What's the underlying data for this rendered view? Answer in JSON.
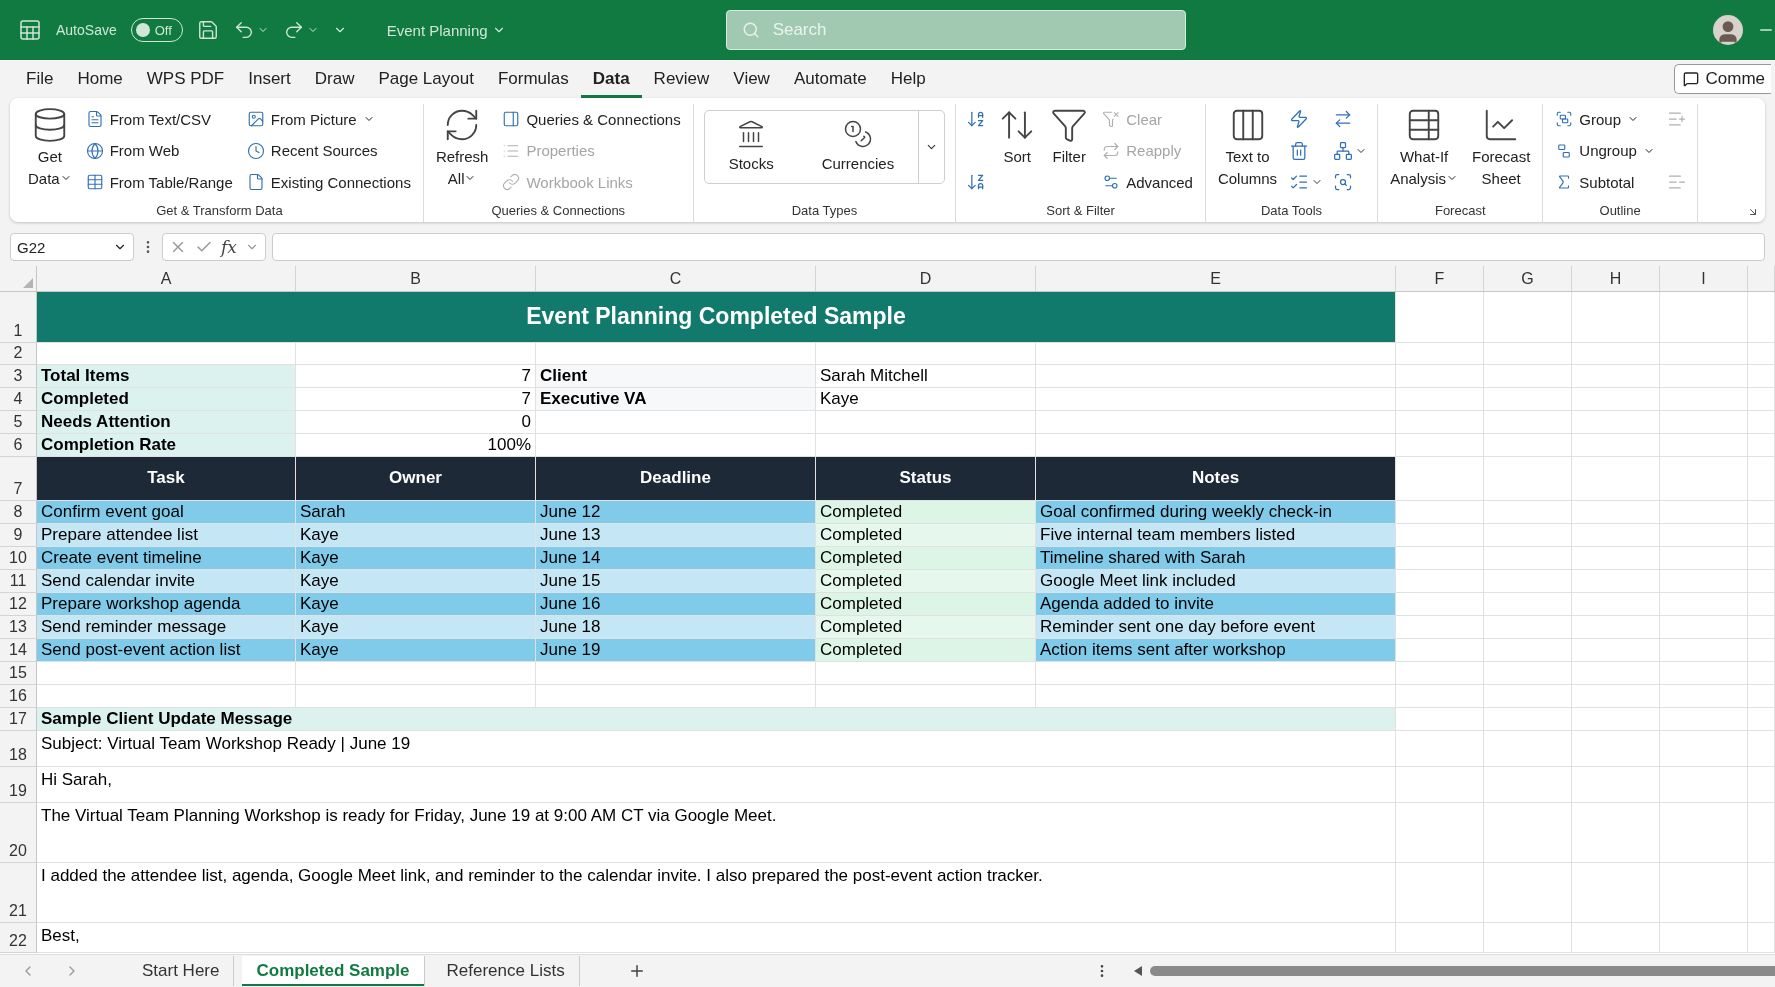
{
  "title_bar": {
    "autosave_label": "AutoSave",
    "autosave_toggle": {
      "label": "Off",
      "on": false
    },
    "document_title": "Event Planning",
    "search": {
      "placeholder": "Search"
    }
  },
  "menu_tabs": [
    {
      "label": "File",
      "selected": false
    },
    {
      "label": "Home",
      "selected": false
    },
    {
      "label": "WPS PDF",
      "selected": false
    },
    {
      "label": "Insert",
      "selected": false
    },
    {
      "label": "Draw",
      "selected": false
    },
    {
      "label": "Page Layout",
      "selected": false
    },
    {
      "label": "Formulas",
      "selected": false
    },
    {
      "label": "Data",
      "selected": true
    },
    {
      "label": "Review",
      "selected": false
    },
    {
      "label": "View",
      "selected": false
    },
    {
      "label": "Automate",
      "selected": false
    },
    {
      "label": "Help",
      "selected": false
    }
  ],
  "comments_button": "Comme",
  "ribbon": {
    "groups": [
      {
        "label": "Get & Transform Data",
        "columns": [
          {
            "kind": "large",
            "lines": [
              "Get",
              "Data"
            ],
            "caret": true
          },
          {
            "kind": "stack",
            "items": [
              {
                "label": "From Text/CSV",
                "disabled": false,
                "caret": false
              },
              {
                "label": "From Web",
                "disabled": false,
                "caret": false
              },
              {
                "label": "From Table/Range",
                "disabled": false,
                "caret": false
              }
            ]
          },
          {
            "kind": "stack",
            "items": [
              {
                "label": "From Picture",
                "disabled": false,
                "caret": true
              },
              {
                "label": "Recent Sources",
                "disabled": false,
                "caret": false
              },
              {
                "label": "Existing Connections",
                "disabled": false,
                "caret": false
              }
            ]
          }
        ]
      },
      {
        "label": "Queries & Connections",
        "columns": [
          {
            "kind": "large",
            "lines": [
              "Refresh",
              "All"
            ],
            "caret": true
          },
          {
            "kind": "stack",
            "items": [
              {
                "label": "Queries & Connections",
                "disabled": false,
                "caret": false
              },
              {
                "label": "Properties",
                "disabled": true,
                "caret": false
              },
              {
                "label": "Workbook Links",
                "disabled": true,
                "caret": false
              }
            ]
          }
        ]
      },
      {
        "label": "Data Types",
        "columns": [
          {
            "kind": "gallery",
            "items": [
              "Stocks",
              "Currencies"
            ]
          }
        ]
      },
      {
        "label": "Sort & Filter",
        "columns": [
          {
            "kind": "icons",
            "items": [
              {
                "disabled": false,
                "caret": false
              },
              {
                "disabled": false,
                "caret": false
              }
            ]
          },
          {
            "kind": "large",
            "lines": [
              "Sort"
            ],
            "caret": false
          },
          {
            "kind": "large",
            "lines": [
              "Filter"
            ],
            "caret": false
          },
          {
            "kind": "stack",
            "items": [
              {
                "label": "Clear",
                "disabled": true,
                "caret": false
              },
              {
                "label": "Reapply",
                "disabled": true,
                "caret": false
              },
              {
                "label": "Advanced",
                "disabled": false,
                "caret": false
              }
            ]
          }
        ]
      },
      {
        "label": "Data Tools",
        "columns": [
          {
            "kind": "large",
            "lines": [
              "Text to",
              "Columns"
            ],
            "caret": false
          },
          {
            "kind": "icons",
            "items": [
              {
                "disabled": false,
                "caret": false
              },
              {
                "disabled": false,
                "caret": false
              },
              {
                "disabled": false,
                "caret": true
              }
            ]
          },
          {
            "kind": "icons",
            "items": [
              {
                "disabled": false,
                "caret": false
              },
              {
                "disabled": false,
                "caret": true
              },
              {
                "disabled": false,
                "caret": false
              }
            ]
          }
        ]
      },
      {
        "label": "Forecast",
        "columns": [
          {
            "kind": "large",
            "lines": [
              "What-If",
              "Analysis"
            ],
            "caret": true
          },
          {
            "kind": "large",
            "lines": [
              "Forecast",
              "Sheet"
            ],
            "caret": false
          }
        ]
      },
      {
        "label": "Outline",
        "columns": [
          {
            "kind": "stack",
            "items": [
              {
                "label": "Group",
                "disabled": false,
                "caret": true
              },
              {
                "label": "Ungroup",
                "disabled": false,
                "caret": true
              },
              {
                "label": "Subtotal",
                "disabled": false,
                "caret": false
              }
            ]
          },
          {
            "kind": "icons",
            "items": [
              {
                "disabled": true,
                "caret": false
              },
              {
                "disabled": true,
                "caret": false
              }
            ]
          }
        ]
      }
    ]
  },
  "formula_bar": {
    "name_box": "G22",
    "function_label": "fx"
  },
  "sheet": {
    "columns": [
      "A",
      "B",
      "C",
      "D",
      "E",
      "F",
      "G",
      "H",
      "I"
    ],
    "row_numbers": [
      "1",
      "2",
      "3",
      "4",
      "5",
      "6",
      "7",
      "8",
      "9",
      "10",
      "11",
      "12",
      "13",
      "14",
      "15",
      "16",
      "17",
      "18",
      "19",
      "20",
      "21",
      "22"
    ],
    "title": "Event Planning Completed Sample",
    "summary": [
      {
        "label": "Total Items",
        "value": "7",
        "side_label": "Client",
        "side_value": "Sarah Mitchell"
      },
      {
        "label": "Completed",
        "value": "7",
        "side_label": "Executive VA",
        "side_value": "Kaye"
      },
      {
        "label": "Needs Attention",
        "value": "0"
      },
      {
        "label": "Completion Rate",
        "value": "100%"
      }
    ],
    "table": {
      "columns": [
        "Task",
        "Owner",
        "Deadline",
        "Status",
        "Notes"
      ],
      "rows": [
        [
          "Confirm event goal",
          "Sarah",
          "June 12",
          "Completed",
          "Goal confirmed during weekly check-in"
        ],
        [
          "Prepare attendee list",
          "Kaye",
          "June 13",
          "Completed",
          "Five internal team members listed"
        ],
        [
          "Create event timeline",
          "Kaye",
          "June 14",
          "Completed",
          "Timeline shared with Sarah"
        ],
        [
          "Send calendar invite",
          "Kaye",
          "June 15",
          "Completed",
          "Google Meet link included"
        ],
        [
          "Prepare workshop agenda",
          "Kaye",
          "June 16",
          "Completed",
          "Agenda added to invite"
        ],
        [
          "Send reminder message",
          "Kaye",
          "June 18",
          "Completed",
          "Reminder sent one day before event"
        ],
        [
          "Send post-event action list",
          "Kaye",
          "June 19",
          "Completed",
          "Action items sent after workshop"
        ]
      ]
    },
    "message": {
      "heading": "Sample Client Update Message",
      "lines": [
        "Subject: Virtual Team Workshop Ready | June 19",
        "Hi Sarah,",
        "The Virtual Team Planning Workshop is ready for Friday, June 19 at 9:00 AM CT via Google Meet.",
        "I added the attendee list, agenda, Google Meet link, and reminder to the calendar invite. I also prepared the post-event action tracker.",
        "Best,"
      ]
    }
  },
  "sheet_tabs": [
    {
      "label": "Start Here",
      "selected": false
    },
    {
      "label": "Completed Sample",
      "selected": true
    },
    {
      "label": "Reference Lists",
      "selected": false
    }
  ]
}
